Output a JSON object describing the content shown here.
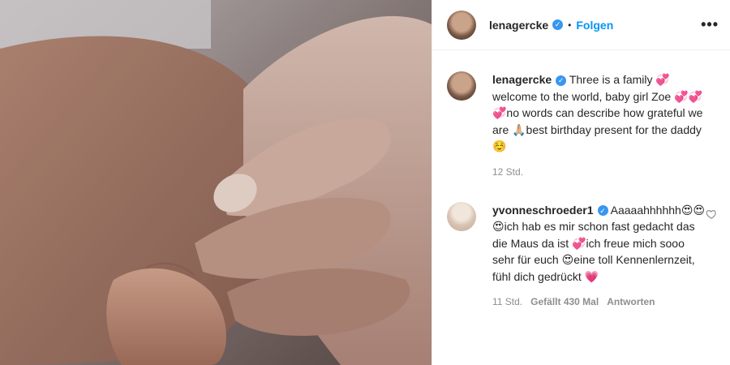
{
  "header": {
    "username": "lenagercke",
    "separator": "•",
    "follow_label": "Folgen",
    "more_label": "•••"
  },
  "caption": {
    "username": "lenagercke",
    "text": "Three is a family 💞 welcome to the world, baby girl Zoe 💞💞💞no words can describe how grateful we are 🙏🏼best birthday present for the daddy ☺️",
    "time": "12 Std."
  },
  "comments": [
    {
      "username": "yvonneschroeder1",
      "text": "Aaaaahhhhhh😍😍😍ich hab es mir schon fast gedacht das die Maus da ist 💞ich freue mich sooo sehr für euch 😍eine toll Kennenlernzeit, fühl dich gedrückt 💗",
      "time": "11 Std.",
      "likes": "Gefällt 430 Mal",
      "reply_label": "Antworten"
    }
  ],
  "icons": {
    "verified": "verified-badge-icon",
    "more": "more-options-icon",
    "like": "heart-outline-icon"
  },
  "colors": {
    "accent": "#0095f6",
    "verified": "#3897f0",
    "meta": "#8e8e8e"
  }
}
